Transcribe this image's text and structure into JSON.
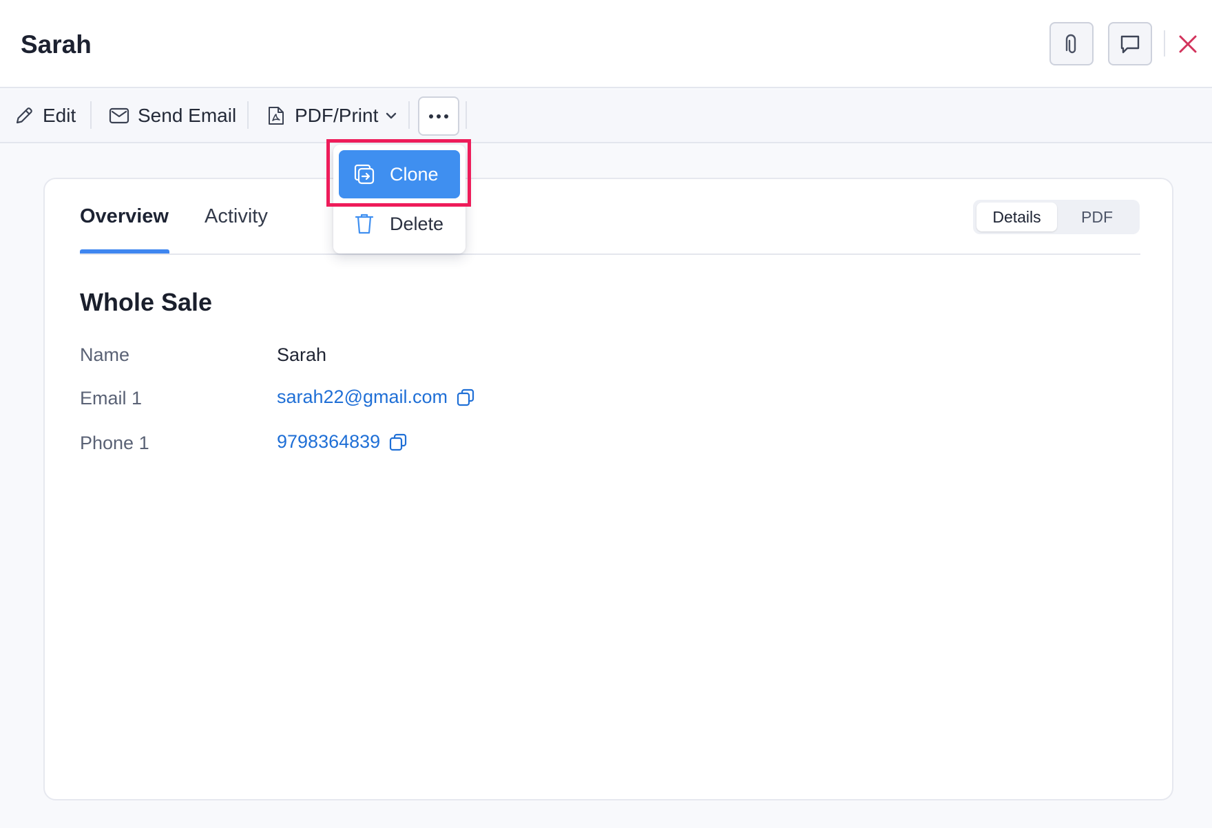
{
  "header": {
    "title": "Sarah",
    "attach_icon": "paperclip-icon",
    "comment_icon": "comment-icon",
    "close_icon": "close-icon"
  },
  "toolbar": {
    "edit_label": "Edit",
    "send_email_label": "Send Email",
    "pdf_print_label": "PDF/Print",
    "more_icon": "more-horizontal-icon"
  },
  "dropdown": {
    "items": [
      {
        "label": "Clone",
        "icon": "clone-icon",
        "state": "active"
      },
      {
        "label": "Delete",
        "icon": "trash-icon",
        "state": "default"
      }
    ]
  },
  "tabs": [
    {
      "label": "Overview",
      "active": true
    },
    {
      "label": "Activity",
      "active": false
    }
  ],
  "view_toggle": {
    "options": [
      "Details",
      "PDF"
    ],
    "selected": "Details"
  },
  "details": {
    "section_title": "Whole Sale",
    "fields": [
      {
        "label": "Name",
        "value": "Sarah",
        "type": "text"
      },
      {
        "label": "Email 1",
        "value": "sarah22@gmail.com",
        "type": "link"
      },
      {
        "label": "Phone 1",
        "value": "9798364839",
        "type": "link"
      }
    ]
  },
  "colors": {
    "accent": "#3f8ff0",
    "link": "#1f6fd6",
    "close": "#d2335c",
    "highlight": "#ee1c5a"
  }
}
